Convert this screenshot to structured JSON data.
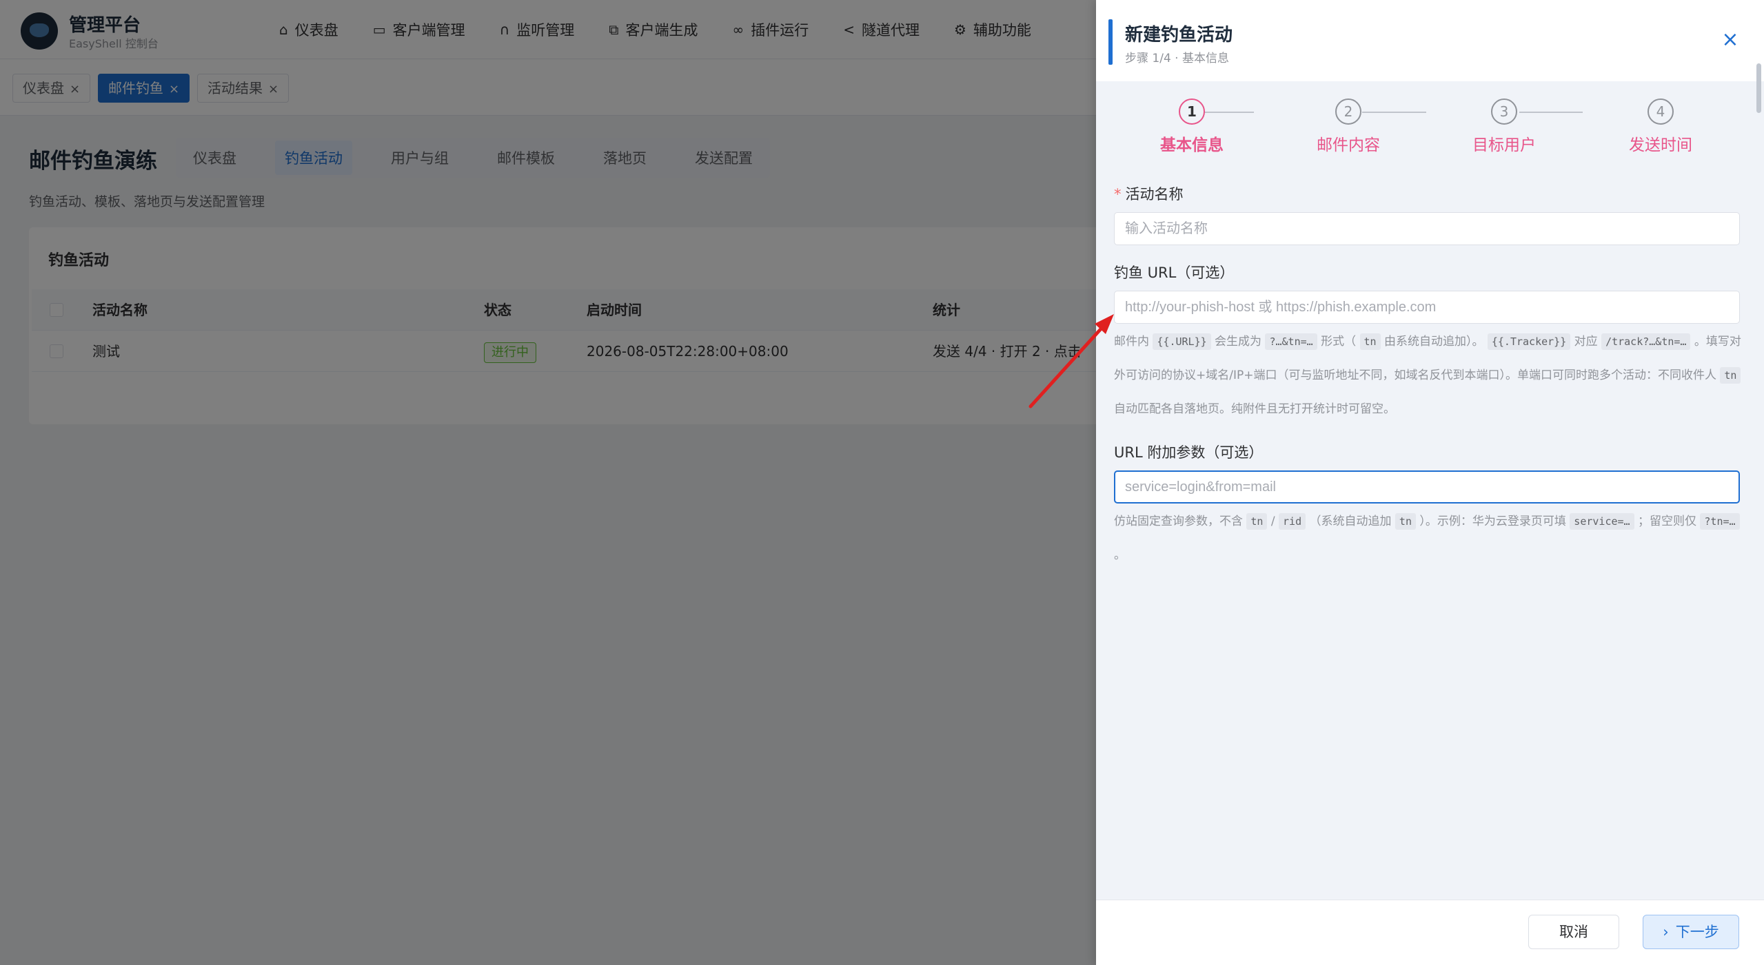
{
  "app": {
    "brand_title": "管理平台",
    "brand_sub": "EasyShell 控制台",
    "nav": [
      {
        "label": "仪表盘",
        "icon": "home-icon"
      },
      {
        "label": "客户端管理",
        "icon": "monitor-icon"
      },
      {
        "label": "监听管理",
        "icon": "headset-icon"
      },
      {
        "label": "客户端生成",
        "icon": "copy-icon"
      },
      {
        "label": "插件运行",
        "icon": "link-icon"
      },
      {
        "label": "隧道代理",
        "icon": "share-icon"
      },
      {
        "label": "辅助功能",
        "icon": "gear-icon"
      }
    ],
    "tags": [
      {
        "label": "仪表盘",
        "active": false
      },
      {
        "label": "邮件钓鱼",
        "active": true
      },
      {
        "label": "活动结果",
        "active": false
      }
    ],
    "page_title": "邮件钓鱼演练",
    "subtabs": [
      "仪表盘",
      "钓鱼活动",
      "用户与组",
      "邮件模板",
      "落地页",
      "发送配置"
    ],
    "active_subtab": "钓鱼活动",
    "page_desc": "钓鱼活动、模板、落地页与发送配置管理",
    "card_title": "钓鱼活动",
    "table": {
      "columns": [
        "活动名称",
        "状态",
        "启动时间",
        "统计"
      ],
      "rows": [
        {
          "name": "测试",
          "status": "进行中",
          "start": "2026-08-05T22:28:00+08:00",
          "stats": "发送 4/4 · 打开 2 · 点击"
        }
      ]
    }
  },
  "drawer": {
    "title": "新建钓鱼活动",
    "subtitle": "步骤 1/4 · 基本信息",
    "close": "×",
    "steps": [
      {
        "num": "1",
        "label": "基本信息"
      },
      {
        "num": "2",
        "label": "邮件内容"
      },
      {
        "num": "3",
        "label": "目标用户"
      },
      {
        "num": "4",
        "label": "发送时间"
      }
    ],
    "current_step": 1,
    "form": {
      "name_label": "活动名称",
      "name_required": "*",
      "name_placeholder": "输入活动名称",
      "url_label": "钓鱼 URL（可选）",
      "url_placeholder": "http://your-phish-host 或 https://phish.example.com",
      "url_help": {
        "t1": "邮件内 ",
        "c1": "{{.URL}}",
        "t2": " 会生成为 ",
        "c2": "?…&tn=…",
        "t3": " 形式（ ",
        "c3": "tn",
        "t4": " 由系统自动追加）。 ",
        "c4": "{{.Tracker}}",
        "t5": " 对应 ",
        "c5": "/track?…&tn=…",
        "t6": " 。填写对外可访问的协议+域名/IP+端口（可与监听地址不同，如域名反代到本端口）。单端口可同时跑多个活动：不同收件人 ",
        "c6": "tn",
        "t7": " 自动匹配各自落地页。纯附件且无打开统计时可留空。"
      },
      "params_label": "URL 附加参数（可选）",
      "params_value": "service=login&from=mail",
      "params_help": {
        "t1": "仿站固定查询参数，不含 ",
        "c1": "tn",
        "t2": " / ",
        "c2": "rid",
        "t3": " （系统自动追加 ",
        "c3": "tn",
        "t4": " ）。示例：华为云登录页可填 ",
        "c4": "service=…",
        "t5": " ；留空则仅 ",
        "c5": "?tn=…",
        "t6": " 。"
      }
    },
    "cancel_label": "取消",
    "next_label": "下一步"
  },
  "colors": {
    "primary": "#1f6fd1",
    "step_accent": "#e8558a",
    "success": "#67c23a",
    "annotation_arrow": "#e02020"
  }
}
